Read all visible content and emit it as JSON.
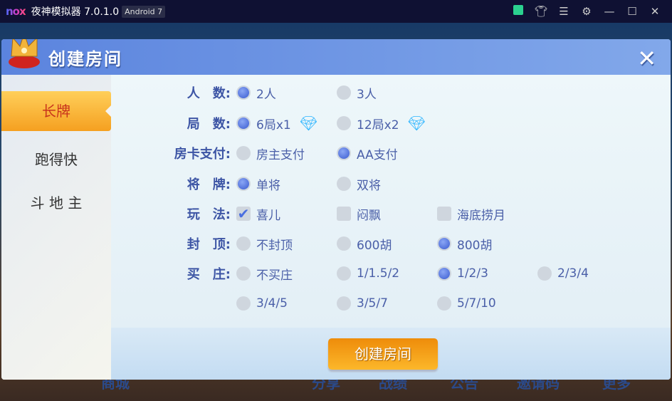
{
  "titlebar": {
    "logo": "nox",
    "title": "夜神模拟器 7.0.1.0",
    "badge": "Android 7",
    "icons": [
      "store-bag-icon",
      "skin-shirt-icon",
      "menu-icon",
      "settings-gear-icon",
      "minimize-icon",
      "maximize-icon",
      "close-icon"
    ]
  },
  "background_nav": [
    "商城",
    "分享",
    "战绩",
    "公告",
    "邀请码",
    "更多"
  ],
  "dialog": {
    "title": "创建房间",
    "close": "✕",
    "create_button": "创建房间"
  },
  "sidebar": {
    "items": [
      {
        "label": "长牌",
        "selected": true
      },
      {
        "label": "跑得快",
        "selected": false
      },
      {
        "label": "斗 地 主",
        "selected": false
      }
    ]
  },
  "colors": {
    "header": "#5b84de",
    "accent": "#f5a020",
    "label": "#3d55a5"
  },
  "rows": [
    {
      "label": "人　数:",
      "type": "radio",
      "options": [
        {
          "text": "2人",
          "on": true
        },
        {
          "text": "3人",
          "on": false
        }
      ]
    },
    {
      "label": "局　数:",
      "type": "radio",
      "options": [
        {
          "text": "6局x1",
          "on": true,
          "gem": true
        },
        {
          "text": "12局x2",
          "on": false,
          "gem": true
        }
      ]
    },
    {
      "label": "房卡支付:",
      "type": "radio",
      "options": [
        {
          "text": "房主支付",
          "on": false
        },
        {
          "text": "AA支付",
          "on": true
        }
      ]
    },
    {
      "label": "将　牌:",
      "type": "radio",
      "options": [
        {
          "text": "单将",
          "on": true
        },
        {
          "text": "双将",
          "on": false
        }
      ]
    },
    {
      "label": "玩　法:",
      "type": "checkbox",
      "options": [
        {
          "text": "喜儿",
          "on": true
        },
        {
          "text": "闷飘",
          "on": false
        },
        {
          "text": "海底捞月",
          "on": false
        }
      ]
    },
    {
      "label": "封　顶:",
      "type": "radio",
      "options": [
        {
          "text": "不封顶",
          "on": false
        },
        {
          "text": "600胡",
          "on": false
        },
        {
          "text": "800胡",
          "on": true
        }
      ]
    },
    {
      "label": "买　庄:",
      "type": "radio",
      "options": [
        {
          "text": "不买庄",
          "on": false
        },
        {
          "text": "1/1.5/2",
          "on": false
        },
        {
          "text": "1/2/3",
          "on": true
        },
        {
          "text": "2/3/4",
          "on": false
        }
      ]
    },
    {
      "label": "",
      "type": "radio",
      "options": [
        {
          "text": "3/4/5",
          "on": false
        },
        {
          "text": "3/5/7",
          "on": false
        },
        {
          "text": "5/7/10",
          "on": false
        }
      ]
    }
  ]
}
